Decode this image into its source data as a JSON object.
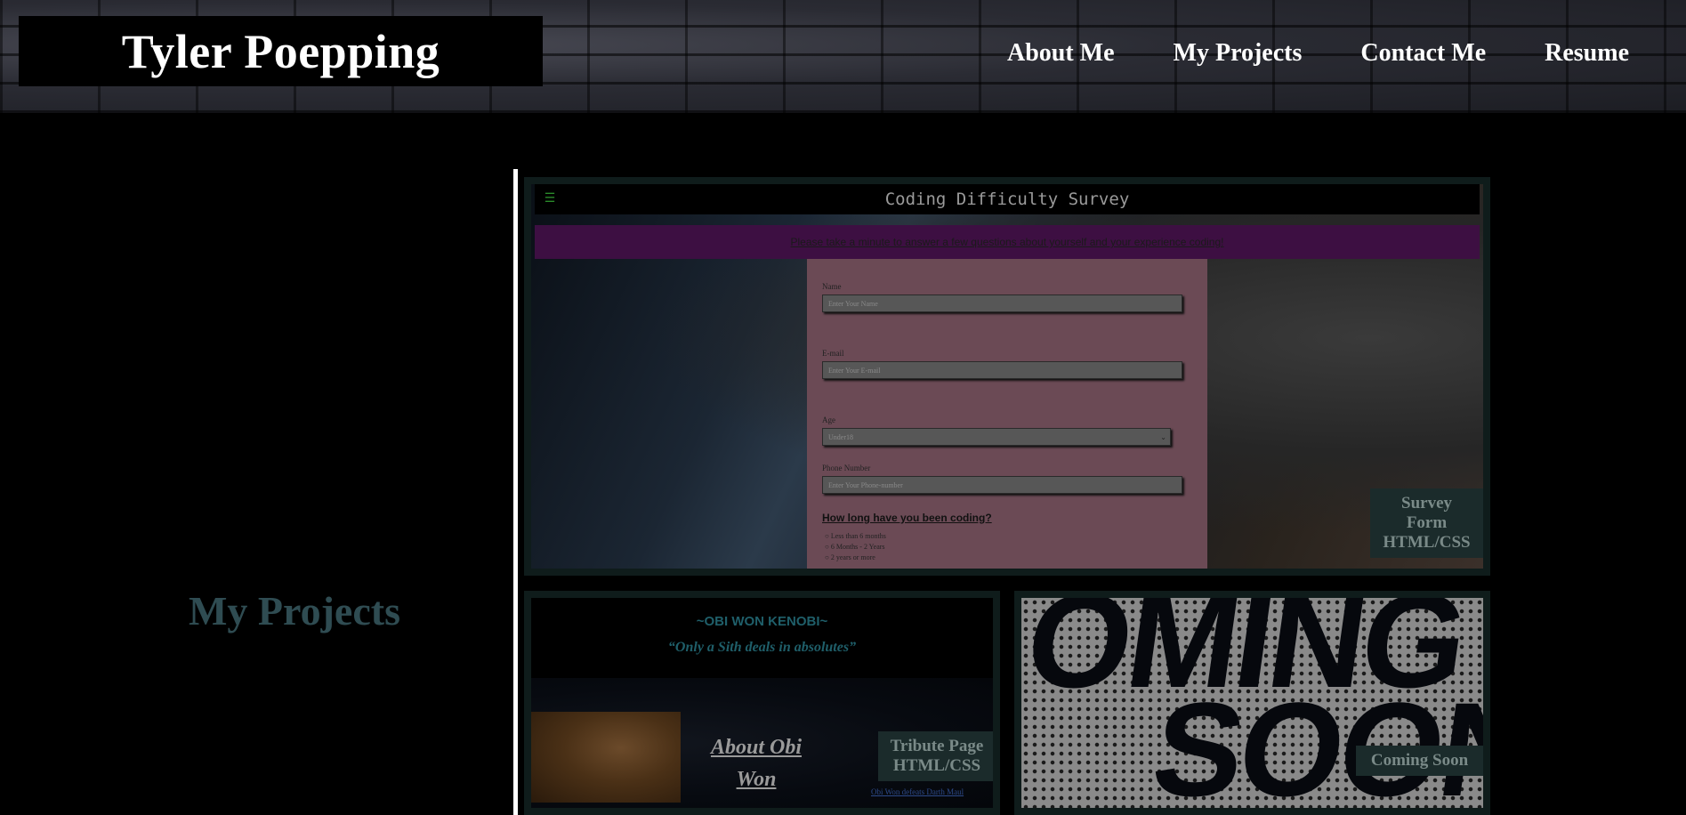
{
  "header": {
    "logo": "Tyler Poepping",
    "nav": [
      "About Me",
      "My Projects",
      "Contact Me",
      "Resume"
    ]
  },
  "section": {
    "title": "My Projects"
  },
  "projects": [
    {
      "caption_line1": "Survey Form",
      "caption_line2": "HTML/CSS",
      "preview": {
        "title": "Coding Difficulty Survey",
        "banner": "Please take a minute to answer a few questions about yourself and your experience coding!",
        "name_label": "Name",
        "name_placeholder": "Enter Your Name",
        "email_label": "E-mail",
        "email_placeholder": "Enter Your E-mail",
        "age_label": "Age",
        "age_value": "Under18",
        "phone_label": "Phone Number",
        "phone_placeholder": "Enter Your Phone-number",
        "question": "How long have you been coding?",
        "options": [
          "Less than 6 months",
          "6 Months - 2 Years",
          "2 years or more"
        ]
      }
    },
    {
      "caption_line1": "Tribute Page",
      "caption_line2": "HTML/CSS",
      "preview": {
        "name": "~OBI WON KENOBI~",
        "quote": "“Only a Sith deals in absolutes”",
        "heading_line1": "About Obi",
        "heading_line2": "Won",
        "link": "Obi Won defeats Darth Maul"
      }
    },
    {
      "caption_line1": "Coming Soon",
      "preview": {
        "line1": "OMING",
        "line2": "SOON"
      }
    }
  ]
}
